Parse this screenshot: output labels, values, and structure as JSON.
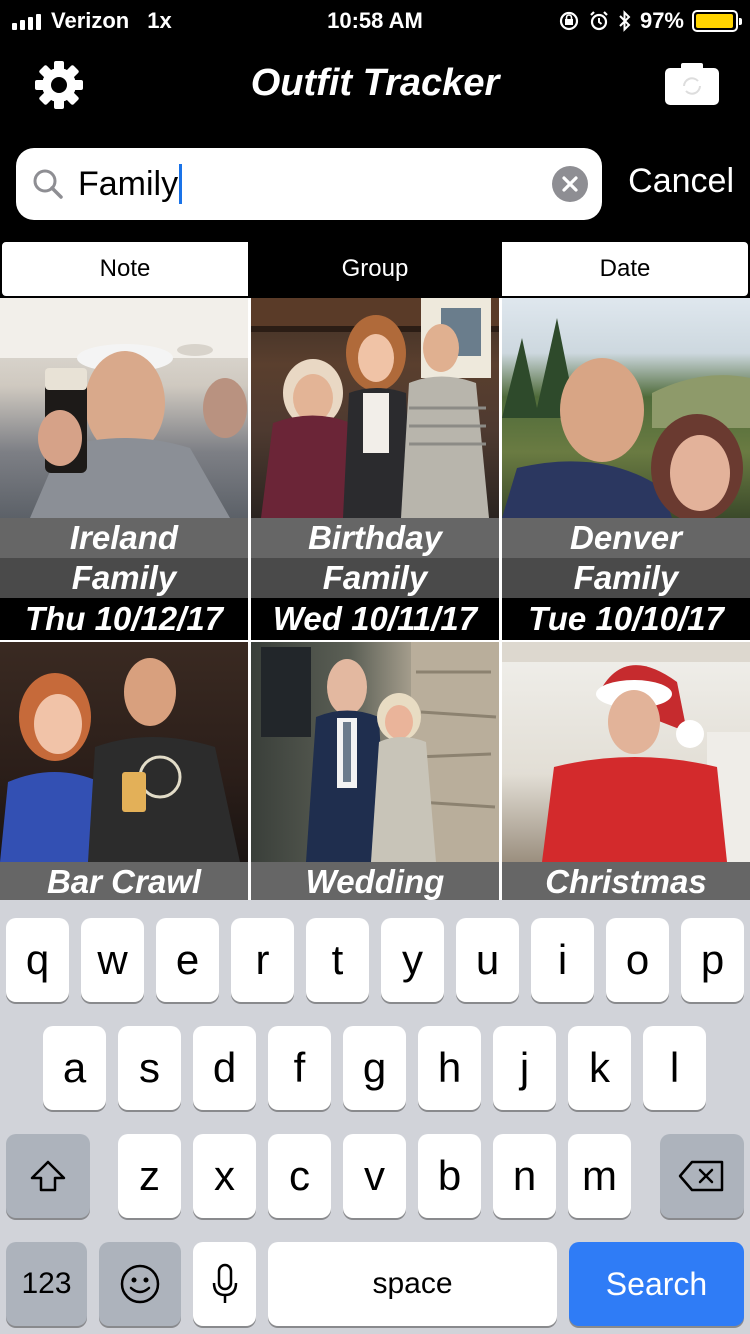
{
  "status_bar": {
    "carrier": "Verizon",
    "network": "1x",
    "time": "10:58 AM",
    "battery_percent": "97%",
    "battery_level": 0.97,
    "battery_color": "#ffd400"
  },
  "nav": {
    "title": "Outfit Tracker",
    "left_icon": "gear-icon",
    "right_icon": "camera-icon"
  },
  "search": {
    "value": "Family",
    "clear_icon": "clear-icon",
    "cancel_label": "Cancel"
  },
  "segments": [
    {
      "label": "Note",
      "selected": false
    },
    {
      "label": "Group",
      "selected": true
    },
    {
      "label": "Date",
      "selected": false
    }
  ],
  "outfits": [
    {
      "name": "Ireland",
      "group": "Family",
      "date": "Thu  10/12/17"
    },
    {
      "name": "Birthday",
      "group": "Family",
      "date": "Wed  10/11/17"
    },
    {
      "name": "Denver",
      "group": "Family",
      "date": "Tue  10/10/17"
    },
    {
      "name": "Bar Crawl",
      "group": "",
      "date": ""
    },
    {
      "name": "Wedding",
      "group": "",
      "date": ""
    },
    {
      "name": "Christmas",
      "group": "",
      "date": ""
    }
  ],
  "keyboard": {
    "row1": [
      "q",
      "w",
      "e",
      "r",
      "t",
      "y",
      "u",
      "i",
      "o",
      "p"
    ],
    "row2": [
      "a",
      "s",
      "d",
      "f",
      "g",
      "h",
      "j",
      "k",
      "l"
    ],
    "row3": [
      "z",
      "x",
      "c",
      "v",
      "b",
      "n",
      "m"
    ],
    "numbers_label": "123",
    "space_label": "space",
    "search_label": "Search",
    "search_key_color": "#2f7cf6"
  }
}
